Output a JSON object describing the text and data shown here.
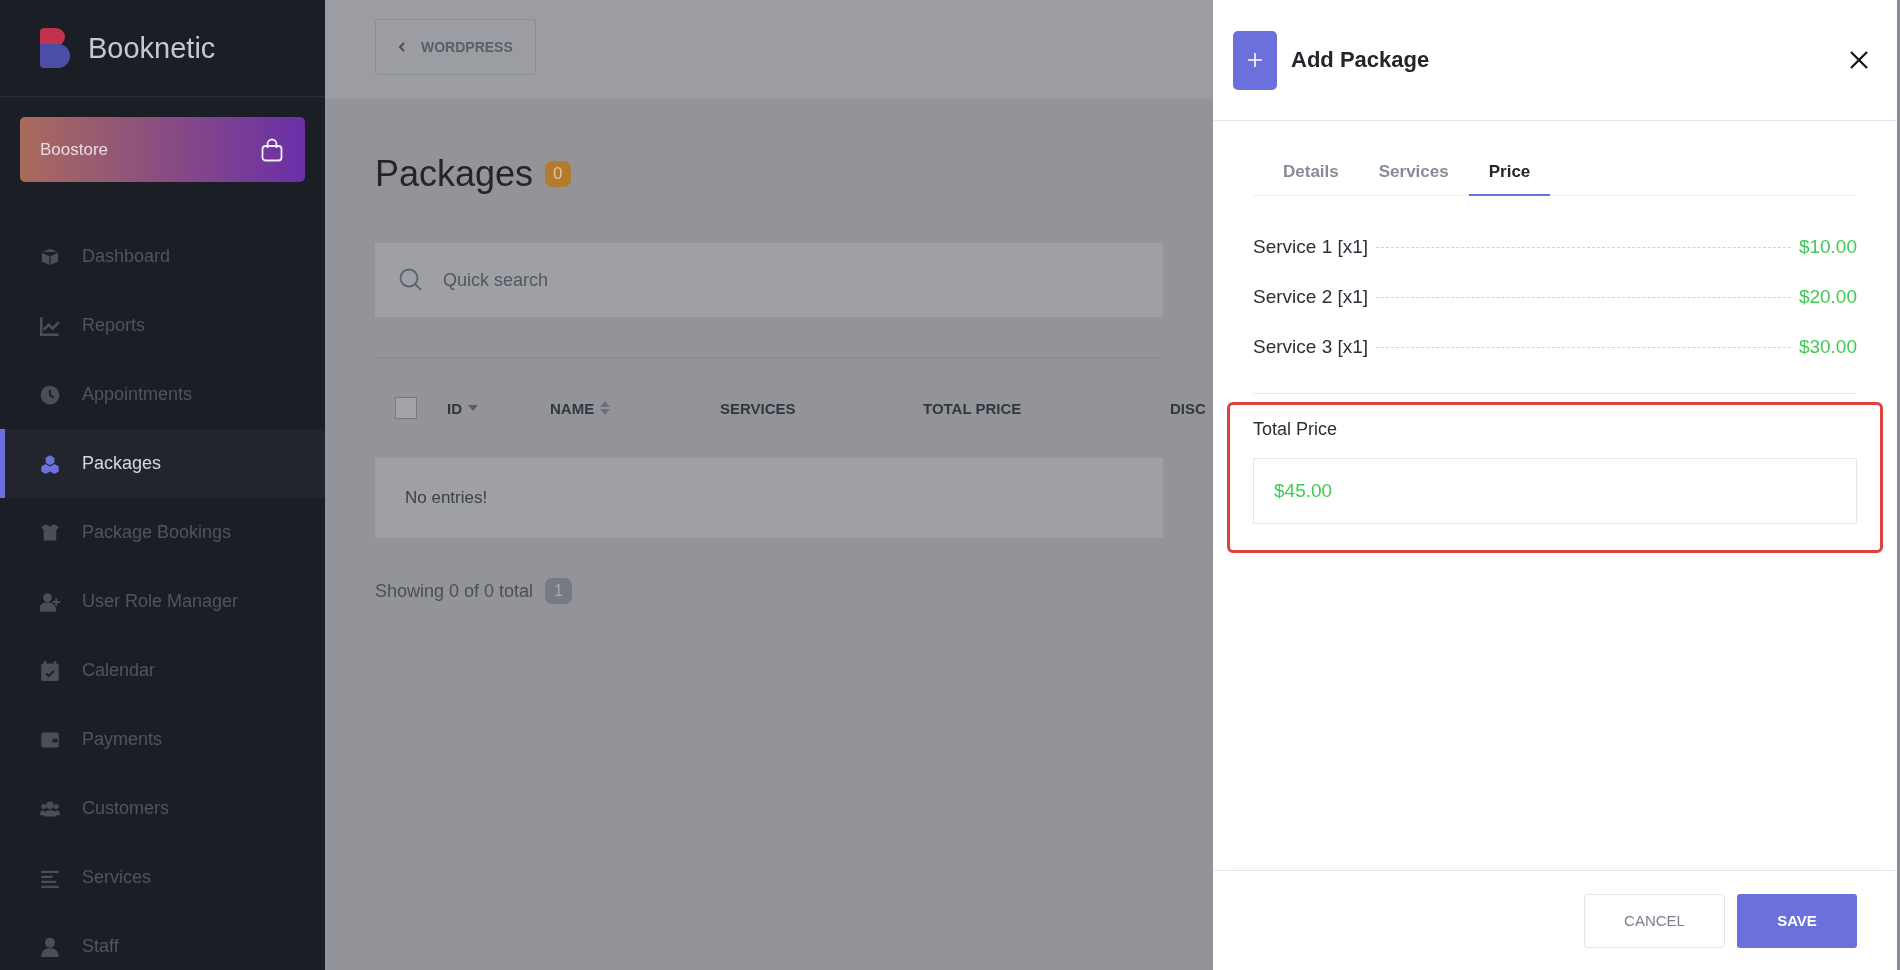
{
  "sidebar": {
    "logo": "Booknetic",
    "store_button": "Boostore",
    "items": [
      {
        "label": "Dashboard",
        "selected": false
      },
      {
        "label": "Reports",
        "selected": false
      },
      {
        "label": "Appointments",
        "selected": false
      },
      {
        "label": "Packages",
        "selected": true
      },
      {
        "label": "Package Bookings",
        "selected": false
      },
      {
        "label": "User Role Manager",
        "selected": false
      },
      {
        "label": "Calendar",
        "selected": false
      },
      {
        "label": "Payments",
        "selected": false
      },
      {
        "label": "Customers",
        "selected": false
      },
      {
        "label": "Services",
        "selected": false
      },
      {
        "label": "Staff",
        "selected": false
      }
    ]
  },
  "main": {
    "back_button": "WORDPRESS",
    "title": "Packages",
    "count": "0",
    "search": {
      "placeholder": "Quick search"
    },
    "table": {
      "select_all": {
        "checked": false
      },
      "columns": [
        {
          "label": "ID",
          "kind": "descending"
        },
        {
          "label": "NAME",
          "kind": "sortable"
        },
        {
          "label": "SERVICES",
          "kind": "plain"
        },
        {
          "label": "TOTAL PRICE",
          "kind": "plain"
        },
        {
          "label": "DISC",
          "kind": "plain"
        }
      ],
      "empty_message": "No entries!"
    },
    "pagination": {
      "summary": "Showing 0 of 0 total",
      "pages": [
        "1"
      ]
    }
  },
  "panel": {
    "title": "Add Package",
    "tabs": [
      {
        "label": "Details",
        "selected": false
      },
      {
        "label": "Services",
        "selected": false
      },
      {
        "label": "Price",
        "selected": true
      }
    ],
    "price_lines": [
      {
        "name": "Service 1",
        "quantity": "[x1]",
        "price": "$10.00"
      },
      {
        "name": "Service 2",
        "quantity": "[x1]",
        "price": "$20.00"
      },
      {
        "name": "Service 3",
        "quantity": "[x1]",
        "price": "$30.00"
      }
    ],
    "total": {
      "label": "Total Price",
      "value": "$45.00",
      "highlighted": true
    },
    "buttons": {
      "cancel": "CANCEL",
      "save": "SAVE"
    }
  }
}
